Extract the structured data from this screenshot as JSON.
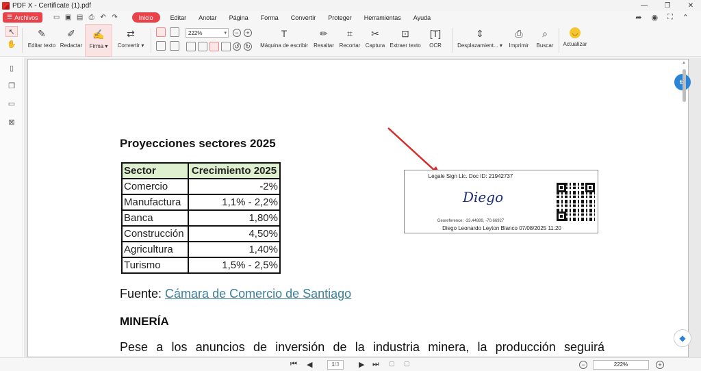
{
  "window": {
    "title": "PDF X - Certificate (1).pdf",
    "controls": {
      "minimize": "—",
      "restore": "❐",
      "close": "✕"
    }
  },
  "menubar": {
    "archivos_label": "Archivos",
    "items": [
      {
        "label": "Inicio",
        "active": true
      },
      {
        "label": "Editar"
      },
      {
        "label": "Anotar"
      },
      {
        "label": "Página"
      },
      {
        "label": "Forma"
      },
      {
        "label": "Convertir"
      },
      {
        "label": "Proteger"
      },
      {
        "label": "Herramientas"
      },
      {
        "label": "Ayuda"
      }
    ]
  },
  "ribbon": {
    "edit_text": "Editar texto",
    "redact": "Redactar",
    "sign": "Firma",
    "convert": "Convertir",
    "zoom_value": "222%",
    "typewriter": "Máquina de escribir",
    "highlight": "Resaltar",
    "crop": "Recortar",
    "capture": "Captura",
    "extract_text": "Extraer texto",
    "ocr": "OCR",
    "scroll": "Desplazamient...",
    "print": "Imprimir",
    "search": "Buscar",
    "update": "Actualizar"
  },
  "document": {
    "heading": "Proyecciones sectores 2025",
    "table": {
      "headers": [
        "Sector",
        "Crecimiento 2025"
      ],
      "rows": [
        [
          "Comercio",
          "-2%"
        ],
        [
          "Manufactura",
          "1,1% - 2,2%"
        ],
        [
          "Banca",
          "1,80%"
        ],
        [
          "Construcción",
          "4,50%"
        ],
        [
          "Agricultura",
          "1,40%"
        ],
        [
          "Turismo",
          "1,5% - 2,5%"
        ]
      ]
    },
    "source_label": "Fuente: ",
    "source_link": "Cámara de Comercio de Santiago",
    "section_title": "MINERÍA",
    "paragraph": "Pese a los anuncios de inversión de la industria minera, la producción seguirá"
  },
  "signature": {
    "doc_id": "Legale Sign Llc. Doc ID: 21942737",
    "name_script": "Diego",
    "georeference": "Georeference: -33.44889, -70.66927",
    "footer": "Diego Leonardo Leyton Blanco 07/08/2025 11:20"
  },
  "statusbar": {
    "current_page": "1",
    "total_pages": "/3",
    "zoom": "222%"
  },
  "colors": {
    "accent": "#e8424a",
    "table_header": "#dff0d0",
    "link": "#3b7f99",
    "arrow": "#d62b2b"
  }
}
